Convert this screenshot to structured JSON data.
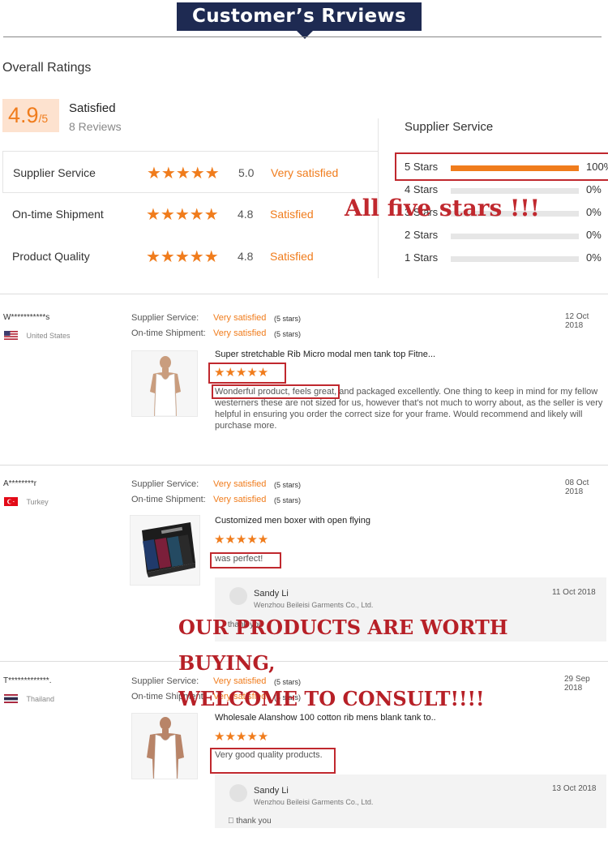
{
  "header": {
    "title": "Customer’s Rrviews"
  },
  "overall": {
    "title": "Overall Ratings",
    "score": "4.9",
    "score_max": "/5",
    "satisfaction": "Satisfied",
    "reviews_count": "8 Reviews"
  },
  "ratings": [
    {
      "label": "Supplier Service",
      "stars": "★★★★★",
      "score": "5.0",
      "text": "Very satisfied"
    },
    {
      "label": "On-time Shipment",
      "stars": "★★★★★",
      "score": "4.8",
      "text": "Satisfied"
    },
    {
      "label": "Product Quality",
      "stars": "★★★★★",
      "score": "4.8",
      "text": "Satisfied"
    }
  ],
  "distribution": {
    "title": "Supplier Service",
    "rows": [
      {
        "label": "5  Stars",
        "pct": "100%",
        "fill": 1.0
      },
      {
        "label": "4  Stars",
        "pct": "0%",
        "fill": 0
      },
      {
        "label": "3  Stars",
        "pct": "0%",
        "fill": 0
      },
      {
        "label": "2  Stars",
        "pct": "0%",
        "fill": 0
      },
      {
        "label": "1  Stars",
        "pct": "0%",
        "fill": 0
      }
    ]
  },
  "overlays": {
    "five_stars": "All five stars !!!",
    "products_line1": "OUR PRODUCTS ARE WORTH BUYING,",
    "products_line2": "WELCOME TO CONSULT!!!!"
  },
  "reviews": [
    {
      "name": "W***********s",
      "country": "United States",
      "supplier_label": "Supplier Service:",
      "supplier_val": "Very satisfied",
      "supplier_stars": "(5 stars)",
      "shipment_label": "On-time Shipment:",
      "shipment_val": "Very satisfied",
      "shipment_stars": "(5 stars)",
      "date": "12 Oct 2018",
      "product_title": "Super stretchable Rib Micro modal men tank top Fitne...",
      "stars": "★★★★★",
      "text_highlight": "Wonderful product, feels great,",
      "text_rest": " and packaged excellently. One thing to keep in mind for my fellow westerners these are not sized for us, however that's not much to worry about, as the seller is very helpful in ensuring you order the correct size for your frame. Would recommend and likely will purchase more."
    },
    {
      "name": "A********r",
      "country": "Turkey",
      "supplier_label": "Supplier Service:",
      "supplier_val": "Very satisfied",
      "supplier_stars": "(5 stars)",
      "shipment_label": "On-time Shipment:",
      "shipment_val": "Very satisfied",
      "shipment_stars": "(5 stars)",
      "date": "08 Oct 2018",
      "product_title": "Customized men boxer with open flying",
      "stars": "★★★★★",
      "text_highlight": "was perfect!",
      "reply": {
        "name": "Sandy Li",
        "company": "Wenzhou Beileisi Garments Co., Ltd.",
        "date": "11 Oct 2018",
        "text": "thank you"
      }
    },
    {
      "name": "T*************.",
      "country": "Thailand",
      "supplier_label": "Supplier Service:",
      "supplier_val": "Very satisfied",
      "supplier_stars": "(5 stars)",
      "shipment_label": "On-time Shipment:",
      "shipment_val": "Very satisfied",
      "shipment_stars": "(5 stars)",
      "date": "29 Sep 2018",
      "product_title": "Wholesale Alanshow 100 cotton rib mens blank tank to..",
      "stars": "★★★★★",
      "text_highlight": "Very good quality products.",
      "reply": {
        "name": "Sandy Li",
        "company": "Wenzhou Beileisi Garments Co., Ltd.",
        "date": "13 Oct 2018",
        "text": "\u0000 thank you"
      }
    }
  ]
}
